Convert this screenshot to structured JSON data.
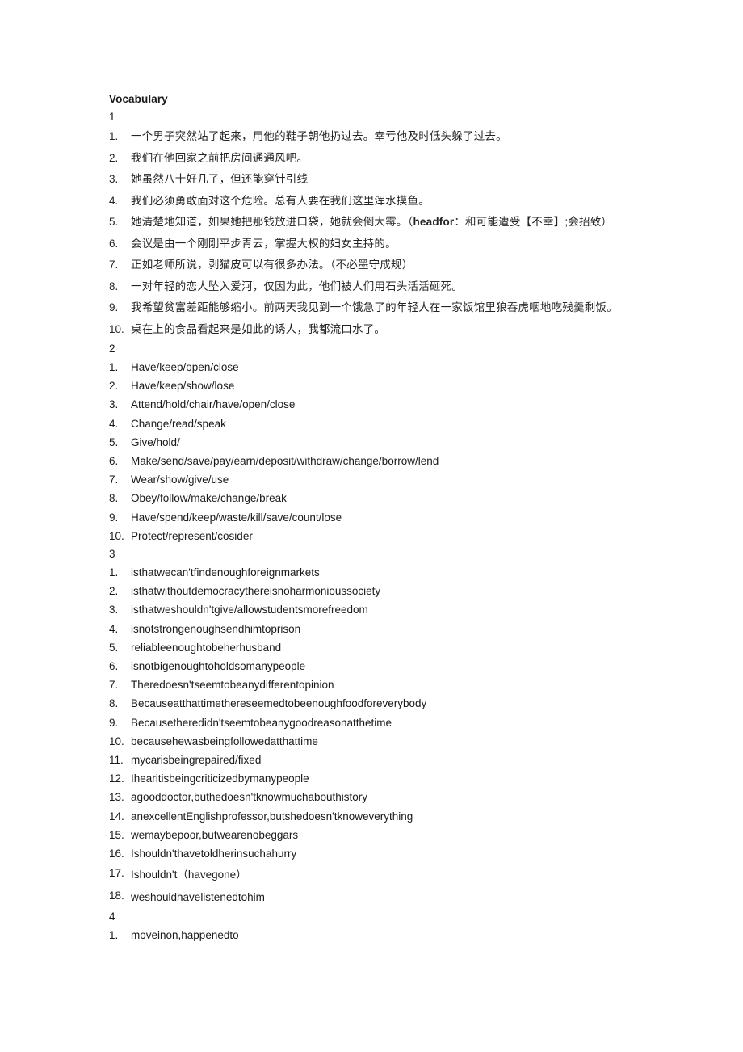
{
  "document": {
    "title": "Vocabulary"
  },
  "sections": [
    {
      "marker": "1",
      "lang": "cn",
      "items": [
        {
          "num": "1.",
          "text": "一个男子突然站了起来，用他的鞋子朝他扔过去。幸亏他及时低头躲了过去。"
        },
        {
          "num": "2.",
          "text": "我们在他回家之前把房间通通风吧。"
        },
        {
          "num": "3.",
          "text": "她虽然八十好几了，但还能穿针引线"
        },
        {
          "num": "4.",
          "text": "我们必须勇敢面对这个危险。总有人要在我们这里浑水摸鱼。"
        },
        {
          "num": "5.",
          "text_before": "她清楚地知道，如果她把那钱放进口袋，她就会倒大霉。（",
          "bold": "headfor",
          "text_after": "：和可能遭受【不幸】;会招致）"
        },
        {
          "num": "6.",
          "text": "会议是由一个刚刚平步青云，掌握大权的妇女主持的。"
        },
        {
          "num": "7.",
          "text": "正如老师所说，剥猫皮可以有很多办法。（不必墨守成规）"
        },
        {
          "num": "8.",
          "text": "一对年轻的恋人坠入爱河，仅因为此，他们被人们用石头活活砸死。"
        },
        {
          "num": "9.",
          "text": "我希望贫富差距能够缩小。前两天我见到一个饿急了的年轻人在一家饭馆里狼吞虎咽地吃残羹剩饭。"
        },
        {
          "num": "10.",
          "text": "桌在上的食品看起来是如此的诱人，我都流口水了。"
        }
      ]
    },
    {
      "marker": "2",
      "lang": "en",
      "items": [
        {
          "num": "1.",
          "text": "Have/keep/open/close"
        },
        {
          "num": "2.",
          "text": "Have/keep/show/lose"
        },
        {
          "num": "3.",
          "text": "Attend/hold/chair/have/open/close"
        },
        {
          "num": "4.",
          "text": "Change/read/speak"
        },
        {
          "num": "5.",
          "text": "Give/hold/"
        },
        {
          "num": "6.",
          "text": "Make/send/save/pay/earn/deposit/withdraw/change/borrow/lend"
        },
        {
          "num": "7.",
          "text": "Wear/show/give/use"
        },
        {
          "num": "8.",
          "text": "Obey/follow/make/change/break"
        },
        {
          "num": "9.",
          "text": "Have/spend/keep/waste/kill/save/count/lose"
        },
        {
          "num": "10.",
          "text": "Protect/represent/cosider"
        }
      ]
    },
    {
      "marker": "3",
      "lang": "en",
      "items": [
        {
          "num": "1.",
          "text": "isthatwecan'tfindenoughforeignmarkets"
        },
        {
          "num": "2.",
          "text": "isthatwithoutdemocracythereisnoharmonioussociety"
        },
        {
          "num": "3.",
          "text": "isthatweshouldn'tgive/allowstudentsmorefreedom"
        },
        {
          "num": "4.",
          "text": "isnotstrongenoughsendhimtoprison"
        },
        {
          "num": "5.",
          "text": "reliableenoughtobeherhusband"
        },
        {
          "num": "6.",
          "text": "isnotbigenoughtoholdsomanypeople"
        },
        {
          "num": "7.",
          "text": "Theredoesn'tseemtobeanydifferentopinion"
        },
        {
          "num": "8.",
          "text": "Becauseatthattimethereseemedtobeenoughfoodforeverybody"
        },
        {
          "num": "9.",
          "text": "Becausetheredidn'tseemtobeanygoodreasonatthetime"
        },
        {
          "num": "10.",
          "text": "becausehewasbeingfollowedatthattime"
        },
        {
          "num": "11.",
          "text": "mycarisbeingrepaired/fixed"
        },
        {
          "num": "12.",
          "text": "Ihearitisbeingcriticizedbymanypeople"
        },
        {
          "num": "13.",
          "text": "agooddoctor,buthedoesn'tknowmuchabouthistory"
        },
        {
          "num": "14.",
          "text": "anexcellentEnglishprofessor,butshedoesn'tknoweverything"
        },
        {
          "num": "15.",
          "text": "wemaybepoor,butwearenobeggars"
        },
        {
          "num": "16.",
          "text": "Ishouldn'thavetoldherinsuchahurry"
        },
        {
          "num": "17.",
          "text": "Ishouldn't（havegone）",
          "loose": true
        },
        {
          "num": "18.",
          "text": "weshouldhavelistenedtohim",
          "loose": true
        }
      ]
    },
    {
      "marker": "4",
      "lang": "en",
      "items": [
        {
          "num": "1.",
          "text": "moveinon,happenedto"
        }
      ]
    }
  ]
}
